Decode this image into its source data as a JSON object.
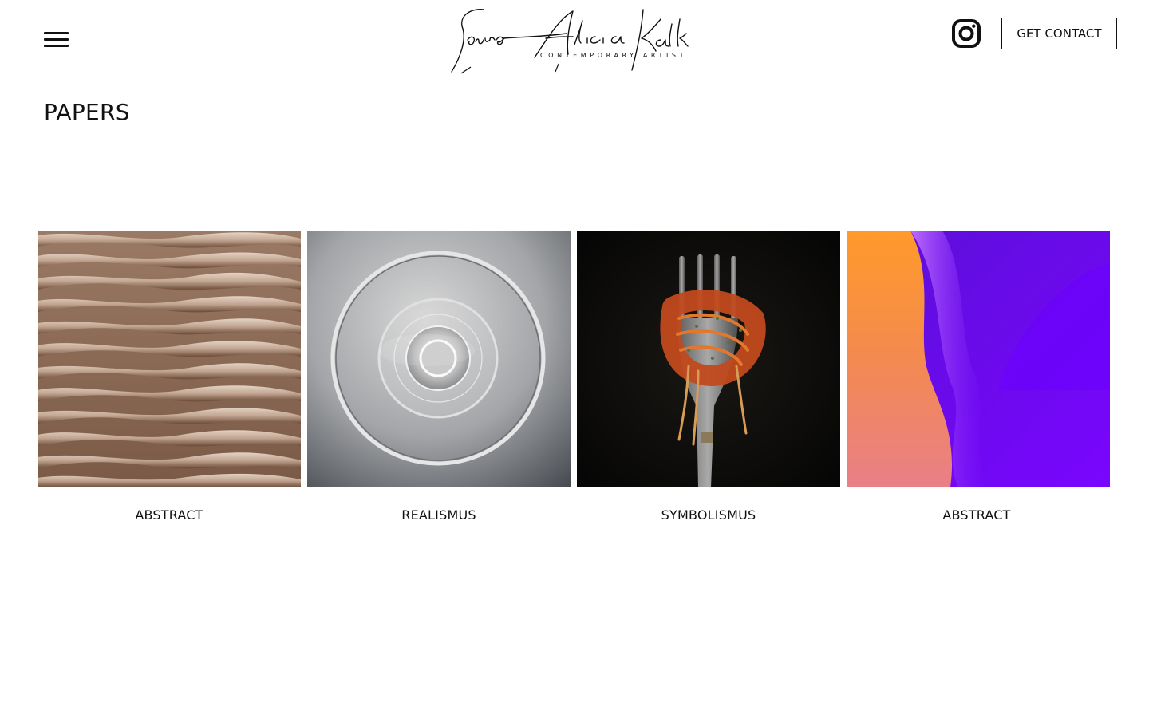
{
  "header": {
    "menu_icon": "hamburger-menu-icon",
    "logo": {
      "signature": "Laura Alicia Kalk",
      "subtitle": "CONTEMPORARY ARTIST"
    },
    "instagram_icon": "instagram-icon",
    "contact_label": "GET CONTACT"
  },
  "page": {
    "title": "PAPERS"
  },
  "gallery": {
    "items": [
      {
        "caption": "ABSTRACT",
        "image": "brown-wave-relief"
      },
      {
        "caption": "REALISMUS",
        "image": "grey-glass-circles"
      },
      {
        "caption": "SYMBOLISMUS",
        "image": "fork-with-spaghetti"
      },
      {
        "caption": "ABSTRACT",
        "image": "purple-orange-gradient"
      }
    ]
  },
  "colors": {
    "text": "#111111",
    "background": "#ffffff"
  }
}
